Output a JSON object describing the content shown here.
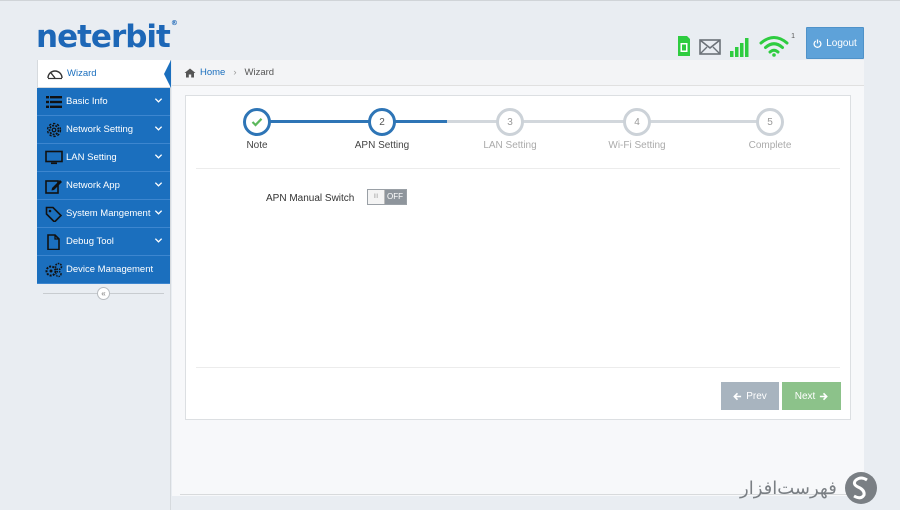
{
  "header": {
    "logo_text": "neterbit",
    "logo_reg": "®",
    "logout_label": "Logout",
    "wifi_clients": "1"
  },
  "breadcrumb": {
    "home": "Home",
    "current": "Wizard"
  },
  "sidebar": {
    "items": [
      {
        "label": "Wizard",
        "icon": "gauge-icon",
        "active": true
      },
      {
        "label": "Basic Info",
        "icon": "list-icon"
      },
      {
        "label": "Network Setting",
        "icon": "gear-icon"
      },
      {
        "label": "LAN Setting",
        "icon": "monitor-icon"
      },
      {
        "label": "Network App",
        "icon": "edit-icon"
      },
      {
        "label": "System Mangement",
        "icon": "tag-icon"
      },
      {
        "label": "Debug Tool",
        "icon": "file-icon"
      },
      {
        "label": "Device Management",
        "icon": "gears-icon"
      }
    ],
    "collapse_glyph": "«"
  },
  "wizard": {
    "steps": [
      {
        "number": "",
        "label": "Note",
        "state": "done"
      },
      {
        "number": "2",
        "label": "APN Setting",
        "state": "current"
      },
      {
        "number": "3",
        "label": "LAN Setting",
        "state": "pending"
      },
      {
        "number": "4",
        "label": "Wi-Fi Setting",
        "state": "pending"
      },
      {
        "number": "5",
        "label": "Complete",
        "state": "pending"
      }
    ],
    "apn_label": "APN Manual Switch",
    "toggle_text": "OFF",
    "toggle_knob": "III",
    "prev_label": "Prev",
    "next_label": "Next"
  },
  "watermark": {
    "text": "فهرست‌افزار"
  },
  "colors": {
    "primary": "#1b6fbe",
    "logo": "#1d67b7",
    "logout": "#5ea2d9",
    "next": "#8cc28a",
    "prev": "#a8b4bf",
    "sim": "#2ecc40",
    "signal": "#2ecc40"
  }
}
